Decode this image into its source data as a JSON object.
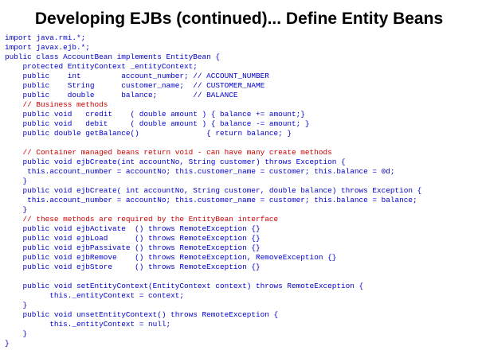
{
  "slide": {
    "title": "Developing EJBs (continued)... Define Entity Beans"
  },
  "code": {
    "text_color": "#0000cc",
    "comment_color": "#cc0000",
    "lines": [
      {
        "text": "import java.rmi.*;",
        "kind": "code"
      },
      {
        "text": "import javax.ejb.*;",
        "kind": "code"
      },
      {
        "text": "public class AccountBean implements EntityBean {",
        "kind": "code"
      },
      {
        "text": "    protected EntityContext _entityContext;",
        "kind": "code"
      },
      {
        "text": "    public    int         account_number; // ACCOUNT_NUMBER",
        "kind": "code"
      },
      {
        "text": "    public    String      customer_name;  // CUSTOMER_NAME",
        "kind": "code"
      },
      {
        "text": "    public    double      balance;        // BALANCE",
        "kind": "code"
      },
      {
        "text": "    // Business methods",
        "kind": "comment"
      },
      {
        "text": "    public void   credit    ( double amount ) { balance += amount;}",
        "kind": "code"
      },
      {
        "text": "    public void   debit     ( double amount ) { balance -= amount; }",
        "kind": "code"
      },
      {
        "text": "    public double getBalance()               { return balance; }",
        "kind": "code"
      },
      {
        "text": "",
        "kind": "code"
      },
      {
        "text": "    // Container managed beans return void - can have many create methods",
        "kind": "comment"
      },
      {
        "text": "    public void ejbCreate(int accountNo, String customer) throws Exception {",
        "kind": "code"
      },
      {
        "text": "     this.account_number = accountNo; this.customer_name = customer; this.balance = 0d;",
        "kind": "code"
      },
      {
        "text": "    }",
        "kind": "code"
      },
      {
        "text": "    public void ejbCreate( int accountNo, String customer, double balance) throws Exception {",
        "kind": "code"
      },
      {
        "text": "     this.account_number = accountNo; this.customer_name = customer; this.balance = balance;",
        "kind": "code"
      },
      {
        "text": "    }",
        "kind": "code"
      },
      {
        "text": "    // these methods are required by the EntityBean interface",
        "kind": "comment"
      },
      {
        "text": "    public void ejbActivate  () throws RemoteException {}",
        "kind": "code"
      },
      {
        "text": "    public void ejbLoad      () throws RemoteException {}",
        "kind": "code"
      },
      {
        "text": "    public void ejbPassivate () throws RemoteException {}",
        "kind": "code"
      },
      {
        "text": "    public void ejbRemove    () throws RemoteException, RemoveException {}",
        "kind": "code"
      },
      {
        "text": "    public void ejbStore     () throws RemoteException {}",
        "kind": "code"
      },
      {
        "text": "",
        "kind": "code"
      },
      {
        "text": "    public void setEntityContext(EntityContext context) throws RemoteException {",
        "kind": "code"
      },
      {
        "text": "          this._entityContext = context;",
        "kind": "code"
      },
      {
        "text": "    }",
        "kind": "code"
      },
      {
        "text": "    public void unsetEntityContext() throws RemoteException {",
        "kind": "code"
      },
      {
        "text": "          this._entityContext = null;",
        "kind": "code"
      },
      {
        "text": "    }",
        "kind": "code"
      },
      {
        "text": "}",
        "kind": "code"
      }
    ]
  }
}
